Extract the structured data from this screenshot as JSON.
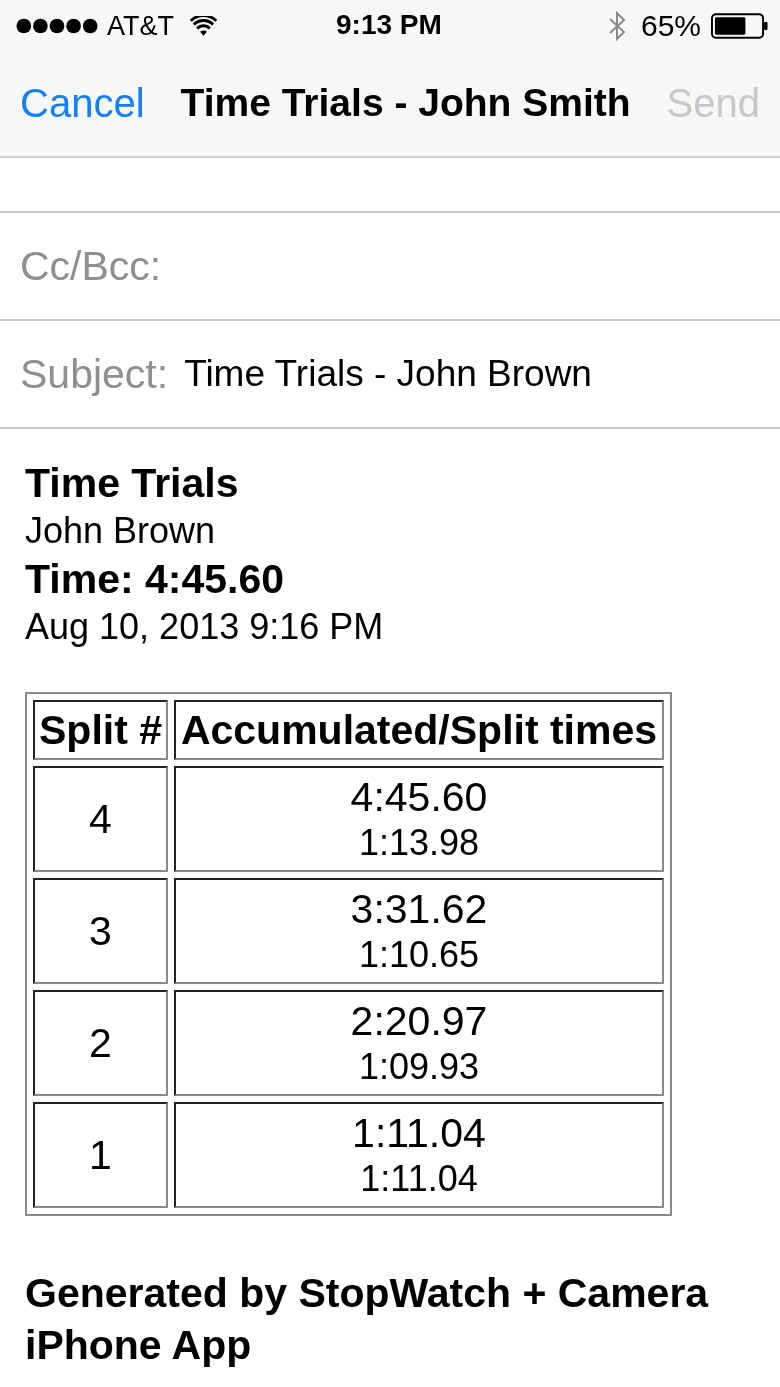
{
  "status_bar": {
    "carrier": "AT&T",
    "time": "9:13 PM",
    "battery": "65%"
  },
  "nav_bar": {
    "cancel": "Cancel",
    "title": "Time Trials - John Smith",
    "send": {
      "label": "Send",
      "disabled": true
    }
  },
  "fields": [
    {
      "label": "Cc/Bcc:"
    },
    {
      "label": "Subject:",
      "value": "Time Trials - John Brown"
    }
  ],
  "body": {
    "title": "Time Trials",
    "name": "John Brown",
    "time": "Time: 4:45.60",
    "date": "Aug 10, 2013 9:16 PM"
  },
  "table": {
    "columns": [
      "Split #",
      "Accumulated/Split times"
    ],
    "rows": [
      {
        "split": "4",
        "accumulated": "4:45.60",
        "split_time": "1:13.98"
      },
      {
        "split": "3",
        "accumulated": "3:31.62",
        "split_time": "1:10.65"
      },
      {
        "split": "2",
        "accumulated": "2:20.97",
        "split_time": "1:09.93"
      },
      {
        "split": "1",
        "accumulated": "1:11.04",
        "split_time": "1:11.04"
      }
    ]
  },
  "footer": "Generated by StopWatch + Camera iPhone App"
}
